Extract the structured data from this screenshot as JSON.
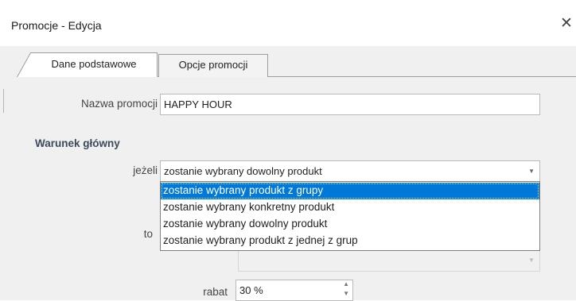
{
  "window": {
    "title": "Promocje - Edycja",
    "close_glyph": "✕"
  },
  "tabs": [
    {
      "label": "Dane podstawowe",
      "active": true
    },
    {
      "label": "Opcje promocji",
      "active": false
    }
  ],
  "form": {
    "name_label": "Nazwa promocji",
    "name_value": "HAPPY HOUR",
    "section_title": "Warunek główny",
    "if_label": "jeżeli",
    "if_value": "zostanie wybrany dowolny produkt",
    "dropdown_options": [
      {
        "text": "zostanie wybrany produkt z grupy",
        "highlighted": true
      },
      {
        "text": "zostanie wybrany konkretny produkt",
        "highlighted": false
      },
      {
        "text": "zostanie wybrany dowolny produkt",
        "highlighted": false
      },
      {
        "text": "zostanie wybrany produkt z jednej z grup",
        "highlighted": false
      }
    ],
    "then_label": "to",
    "discount_label": "rabat",
    "discount_value": "30 %"
  },
  "icons": {
    "select_arrow": "chevron-down-icon",
    "spin_up": "chevron-up-icon",
    "spin_down": "chevron-down-icon",
    "close": "close-icon"
  },
  "colors": {
    "selection": "#0078d7",
    "section_heading": "#3c4a5c",
    "background": "#f0f0f0"
  }
}
